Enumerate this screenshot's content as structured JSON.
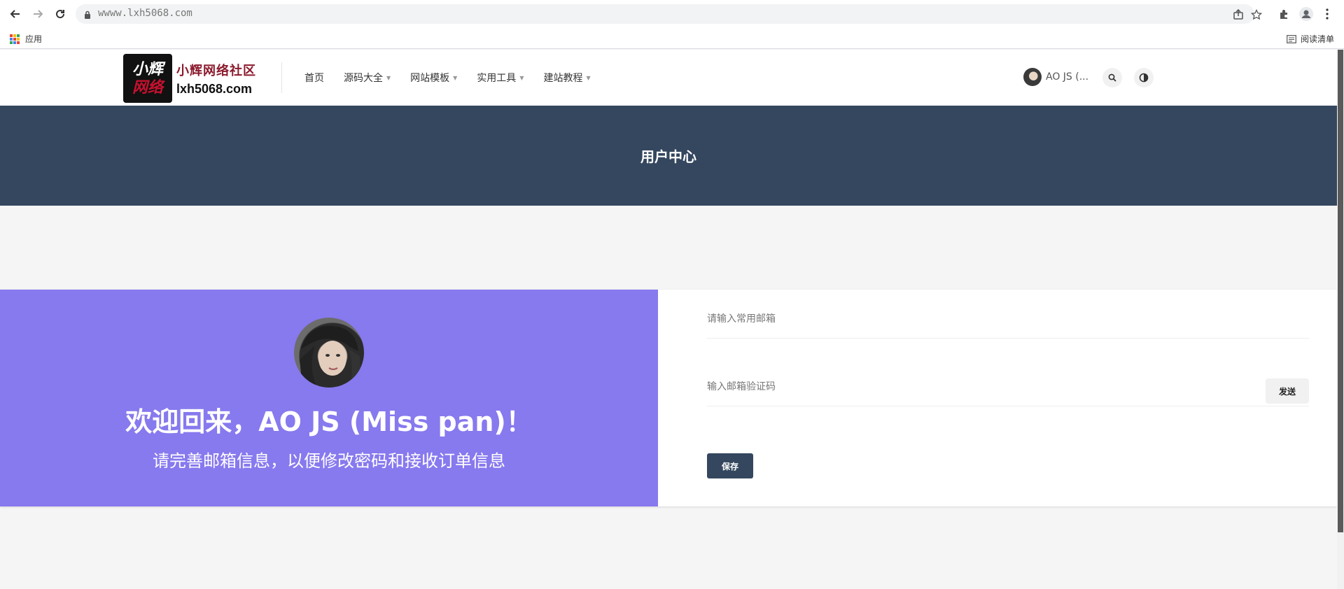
{
  "browser": {
    "url": "wwww.lxh5068.com",
    "bookmarks": {
      "apps_label": "应用",
      "reading_list_label": "阅读清单"
    }
  },
  "site": {
    "logo": {
      "badge_line1": "小辉",
      "badge_line2": "网络",
      "cn_name": "小辉网络社区",
      "domain": "lxh5068.com"
    },
    "menu": [
      {
        "label": "首页",
        "has_dropdown": false
      },
      {
        "label": "源码大全",
        "has_dropdown": true
      },
      {
        "label": "网站模板",
        "has_dropdown": true
      },
      {
        "label": "实用工具",
        "has_dropdown": true
      },
      {
        "label": "建站教程",
        "has_dropdown": true
      }
    ],
    "user_chip_label": "AO JS (..."
  },
  "hero": {
    "title": "用户中心"
  },
  "profile": {
    "welcome": "欢迎回来，AO JS (Miss pan)！",
    "subtitle": "请完善邮箱信息，以便修改密码和接收订单信息"
  },
  "form": {
    "email_placeholder": "请输入常用邮箱",
    "code_placeholder": "输入邮箱验证码",
    "send_label": "发送",
    "save_label": "保存"
  },
  "colors": {
    "hero_bg": "#34475f",
    "profile_bg": "#8779ee",
    "logo_red": "#8b1a2d"
  }
}
